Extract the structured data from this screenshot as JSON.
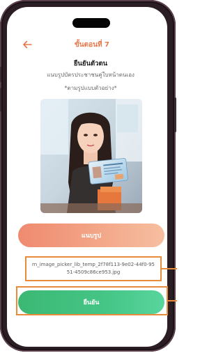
{
  "header": {
    "step_label": "ขั้นตอนที่  7"
  },
  "content": {
    "title": "ยืนยันตัวตน",
    "subtitle": "แนบรูปบัตรประชาชนคู่ใบหน้าตนเอง",
    "note": "*ตามรูปแบบตัวอย่าง*"
  },
  "photo": {
    "description_icon": "selfie-with-id-card-photo"
  },
  "actions": {
    "upload_label": "แนบรูป",
    "file_name": "rn_image_picker_lib_temp_2f78f113-9e02-44f0-9551-4509c86ce953.jpg",
    "confirm_label": "ยืนยัน"
  },
  "colors": {
    "accent_orange": "#e8764b",
    "upload_button": "#f3a688",
    "confirm_button": "#45c586",
    "highlight_frame": "#e88b3b"
  }
}
